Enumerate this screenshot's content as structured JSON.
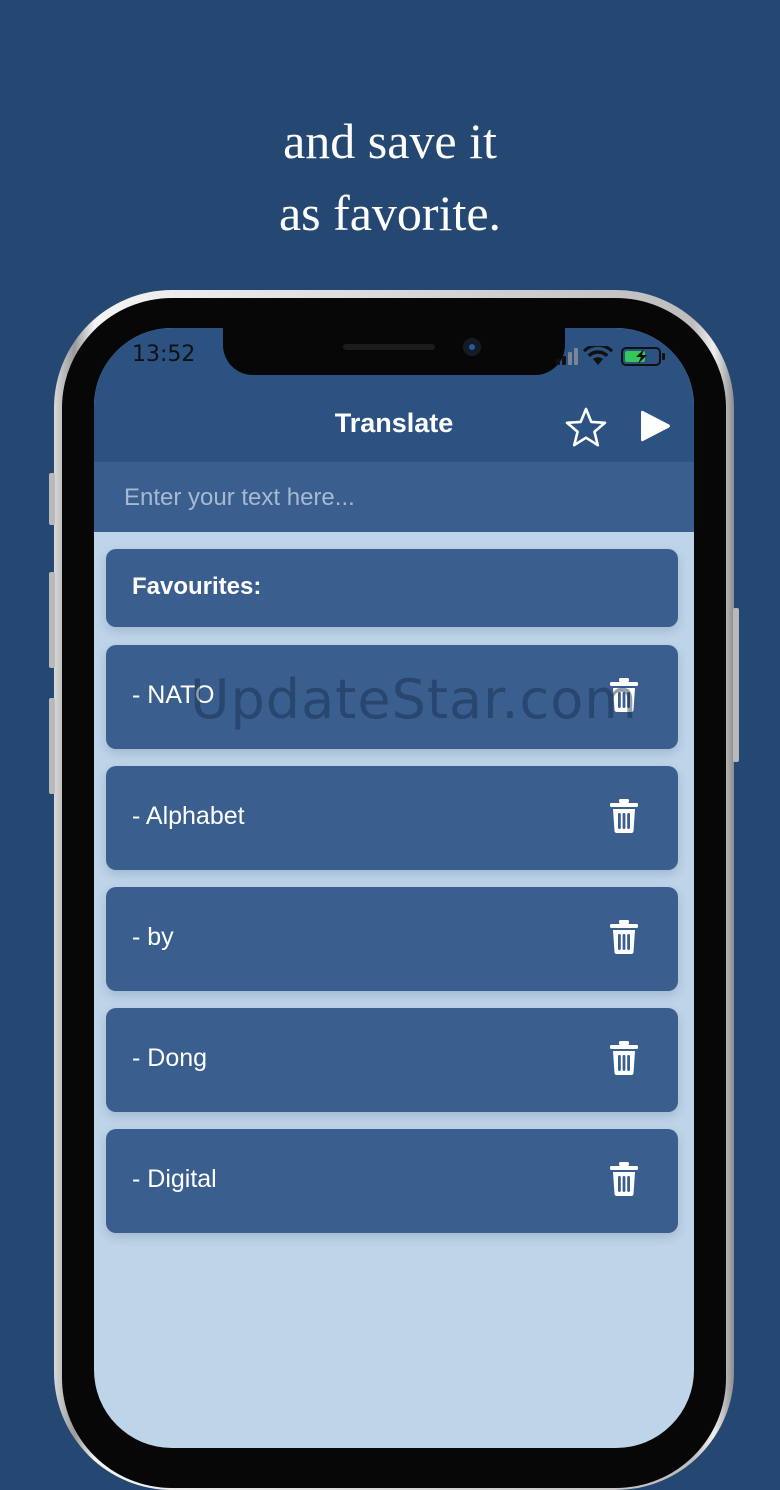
{
  "headline": {
    "line1": "and save it",
    "line2": "as favorite."
  },
  "status_bar": {
    "time": "13:52",
    "icons": [
      "signal-icon",
      "wifi-icon",
      "battery-charging-icon"
    ],
    "battery_color": "#34c759"
  },
  "nav": {
    "title": "Translate",
    "favorite_icon": "star-outline-icon",
    "play_icon": "play-icon"
  },
  "input": {
    "placeholder": "Enter your text here...",
    "value": ""
  },
  "favourites": {
    "header": "Favourites:",
    "items": [
      {
        "label": "- NATO"
      },
      {
        "label": "- Alphabet"
      },
      {
        "label": "- by"
      },
      {
        "label": "- Dong"
      },
      {
        "label": "- Digital"
      }
    ],
    "delete_icon": "trash-icon"
  },
  "watermark": "UpdateStar.com",
  "colors": {
    "page_background": "#244872",
    "nav_background": "#2c5282",
    "card_background": "#3a5f8f",
    "list_background": "#bed4e8"
  }
}
